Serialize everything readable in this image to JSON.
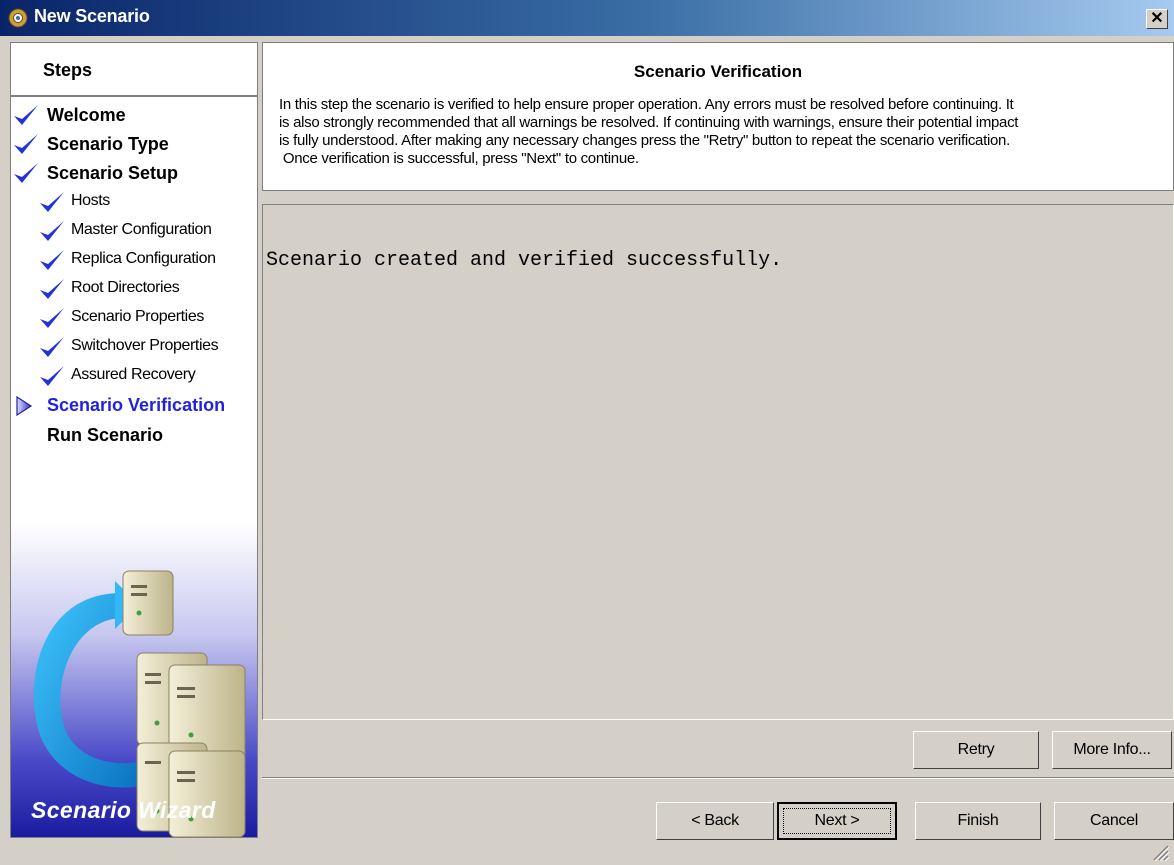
{
  "window": {
    "title": "New Scenario",
    "close_glyph": "✕",
    "icon": "scenario-gear-icon"
  },
  "sidebar": {
    "heading": "Steps",
    "steps": [
      {
        "label": "Welcome",
        "level": "main",
        "status": "done"
      },
      {
        "label": "Scenario Type",
        "level": "main",
        "status": "done"
      },
      {
        "label": "Scenario Setup",
        "level": "main",
        "status": "done"
      },
      {
        "label": "Hosts",
        "level": "sub",
        "status": "done"
      },
      {
        "label": "Master Configuration",
        "level": "sub",
        "status": "done"
      },
      {
        "label": "Replica Configuration",
        "level": "sub",
        "status": "done"
      },
      {
        "label": "Root Directories",
        "level": "sub",
        "status": "done"
      },
      {
        "label": "Scenario Properties",
        "level": "sub",
        "status": "done"
      },
      {
        "label": "Switchover Properties",
        "level": "sub",
        "status": "done"
      },
      {
        "label": "Assured Recovery",
        "level": "sub",
        "status": "done"
      },
      {
        "label": "Scenario Verification",
        "level": "main",
        "status": "current"
      },
      {
        "label": "Run Scenario",
        "level": "main",
        "status": "pending"
      }
    ],
    "art_caption": "Scenario Wizard"
  },
  "header": {
    "title": "Scenario Verification",
    "description_lines": [
      "In this step the scenario is verified to help ensure proper operation. Any errors must be resolved before continuing. It",
      "is also strongly recommended that all warnings be resolved. If continuing with warnings, ensure their potential impact",
      "is fully understood. After making any necessary changes press the \"Retry\" button to repeat the scenario verification.",
      " Once verification is successful, press \"Next\" to continue."
    ]
  },
  "output": {
    "message": "Scenario created and verified successfully."
  },
  "buttons": {
    "retry": "Retry",
    "more_info": "More Info...",
    "back": "< Back",
    "next": "Next >",
    "finish": "Finish",
    "cancel": "Cancel"
  },
  "colors": {
    "check": "#2233dd",
    "current_step": "#2222dd",
    "title_bar": "#0a246a",
    "art_bottom": "#1a1aa0"
  }
}
